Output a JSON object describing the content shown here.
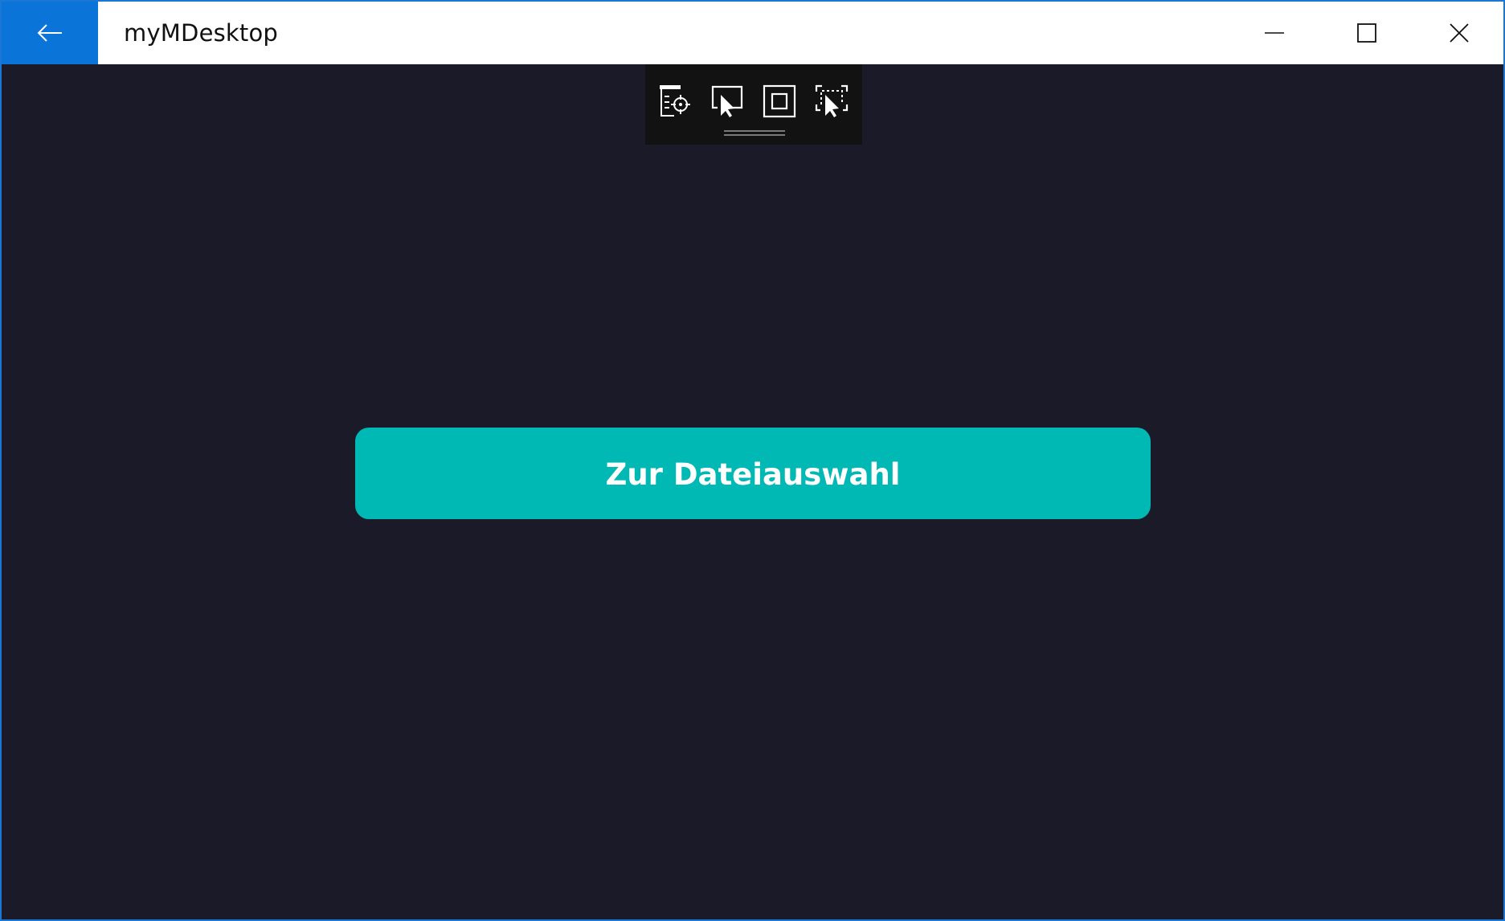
{
  "window": {
    "title": "myMDesktop",
    "border_color": "#1a78d4",
    "background": "#1b1a28"
  },
  "titlebar": {
    "back_icon": "arrow-left-icon",
    "back_accent": "#0a74d8",
    "minimize_icon": "minimize-icon",
    "maximize_icon": "maximize-icon",
    "close_icon": "close-icon"
  },
  "debug_toolbar": {
    "tools": [
      {
        "icon": "visual-tree-target-icon"
      },
      {
        "icon": "select-element-icon"
      },
      {
        "icon": "display-layout-adorners-icon"
      },
      {
        "icon": "track-focused-element-icon"
      }
    ]
  },
  "main": {
    "button_label": "Zur Dateiauswahl",
    "button_color": "#00b8b4"
  }
}
